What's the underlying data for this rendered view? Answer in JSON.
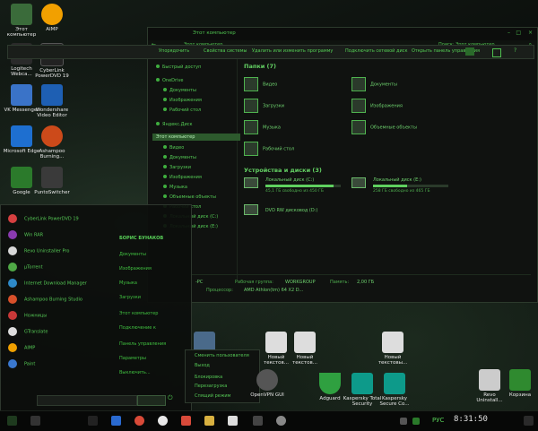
{
  "desktop_icons": [
    {
      "label": "Этот компьютер",
      "color": "#3a6b3a"
    },
    {
      "label": "AIMP",
      "color": "#f2a000"
    },
    {
      "label": "Logitech Webca...",
      "color": "#2a2a2a"
    },
    {
      "label": "CyberLink PowerDVD 19",
      "color": "#222"
    },
    {
      "label": "VK Messenger",
      "color": "#3a73c8"
    },
    {
      "label": "Wondershare Video Editor",
      "color": "#1e5fb3"
    },
    {
      "label": "Microsoft Edge",
      "color": "#1e6fd0"
    },
    {
      "label": "Ashampoo Burning...",
      "color": "#cc4a1a"
    },
    {
      "label": "Google",
      "color": "#2b7a2b"
    },
    {
      "label": "PuntoSwitcher",
      "color": "#3a3a3a"
    }
  ],
  "bottom_desktop_icons": [
    {
      "label": "Новый текстов...",
      "color": "#dddddd"
    },
    {
      "label": "Новый текстовы...",
      "color": "#dddddd"
    },
    {
      "label": "OpenVPN GUI",
      "color": "#555"
    },
    {
      "label": "Adguard",
      "color": "#2fa040"
    },
    {
      "label": "Kaspersky Total Security",
      "color": "#0d9a8a"
    },
    {
      "label": "Kaspersky Secure Co...",
      "color": "#0d9a8a"
    },
    {
      "label": "Revo Uninstall...",
      "color": "#cccccc"
    },
    {
      "label": "Корзина",
      "color": "#2f8a2f"
    }
  ],
  "explorer": {
    "title": "Этот компьютер",
    "search_placeholder": "Поиск: Этот компьютер",
    "commands": [
      "Упорядочить",
      "Свойства системы",
      "Удалить или изменить программу",
      "Подключить сетевой диск",
      "Открыть панель управления"
    ],
    "nav": [
      "Быстрый доступ",
      "OneDrive",
      "Документы",
      "Изображения",
      "Рабочий стол",
      "Яндекс.Диск",
      "Этот компьютер",
      "Видео",
      "Документы",
      "Загрузки",
      "Изображения",
      "Музыка",
      "Объемные объекты",
      "Рабочий стол",
      "Локальный диск (C:)",
      "Локальный диск (E:)"
    ],
    "folders_header": "Папки (7)",
    "folders": [
      "Видео",
      "Документы",
      "Загрузки",
      "Изображения",
      "Музыка",
      "Объемные объекты",
      "Рабочий стол"
    ],
    "devices_header": "Устройства и диски (3)",
    "drives": [
      {
        "name": "Локальный диск (C:)",
        "free": "45,1 ГБ свободно из 450 ГБ",
        "used_fraction": 0.9
      },
      {
        "name": "Локальный диск (E:)",
        "free": "258 ГБ свободно из 465 ГБ",
        "used_fraction": 0.45
      }
    ],
    "dvd": "DVD RW дисковод (D:)",
    "details_name": "-PC",
    "details_workgroup_label": "Рабочая группа:",
    "details_workgroup": "WORKGROUP",
    "details_memory_label": "Память:",
    "details_memory": "2,00 ГБ",
    "details_cpu_label": "Процессор:",
    "details_cpu": "AMD Athlon(tm) 64 X2 D..."
  },
  "start_menu": {
    "apps": [
      {
        "label": "CyberLink PowerDVD 19",
        "color": "#d64040"
      },
      {
        "label": "Win RAR",
        "color": "#8a3ab0"
      },
      {
        "label": "Revo Uninstaller Pro",
        "color": "#d8d8d8"
      },
      {
        "label": "µTorrent",
        "color": "#4fa846"
      },
      {
        "label": "Internet Download Manager",
        "color": "#2e8ac8"
      },
      {
        "label": "Ashampoo Burning Studio",
        "color": "#d8502a"
      },
      {
        "label": "Ножницы",
        "color": "#c83838"
      },
      {
        "label": "GTranslate",
        "color": "#dddddd"
      },
      {
        "label": "AIMP",
        "color": "#f0a000"
      },
      {
        "label": "Paint",
        "color": "#3a78d0"
      }
    ],
    "right": [
      "БОРИС БУНАКОВ",
      "Документы",
      "Изображения",
      "Музыка",
      "Загрузки",
      "Этот компьютер",
      "Подключение к",
      "Панель управления",
      "Параметры",
      "Выключить..."
    ]
  },
  "context_menu": [
    "Сменить пользователя",
    "Выход",
    "Блокировка",
    "Перезагрузка",
    "Спящий режим"
  ],
  "taskbar": {
    "lang": "РУС",
    "time": "8:31:50"
  }
}
